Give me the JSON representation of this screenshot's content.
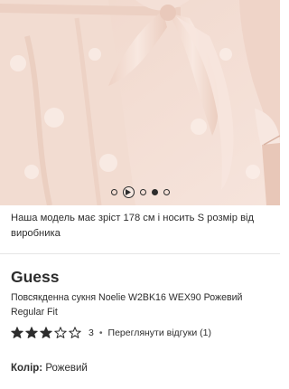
{
  "gallery": {
    "image_alt": "model-wearing-pink-satin-dress",
    "slides_count": 4,
    "active_slide": 3,
    "play_icon": "play-icon"
  },
  "model_note": "Наша модель має зріст 178 см і носить S розмір від виробника",
  "product": {
    "brand": "Guess",
    "name": "Повсякденна сукня Noelie W2BK16 WEX90 Рожевий Regular Fit"
  },
  "rating": {
    "value": 3,
    "max": 5,
    "count_text": "3",
    "separator": "•",
    "reviews_link": "Переглянути відгуки (1)"
  },
  "color": {
    "label": "Колір:",
    "value": "Рожевий"
  },
  "colors": {
    "text": "#2d2d2d",
    "fabric": "#f3ddd3"
  }
}
